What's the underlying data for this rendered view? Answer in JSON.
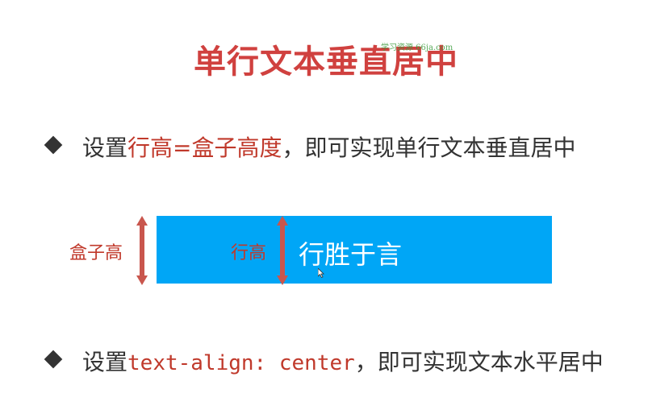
{
  "slide": {
    "title": "单行文本垂直居中",
    "watermark": "学习资源 66ja.com",
    "bullet1": {
      "prefix": "设置",
      "highlight": "行高=盒子高度",
      "suffix": "，即可实现单行文本垂直居中"
    },
    "diagram": {
      "box_height_label": "盒子高",
      "line_height_label": "行高",
      "box_text": "行胜于言",
      "box_color": "#00a6f6",
      "arrow_color": "#c9564d"
    },
    "bullet2": {
      "prefix": "设置",
      "code": "text-align: center",
      "suffix": "，即可实现文本水平居中"
    }
  }
}
